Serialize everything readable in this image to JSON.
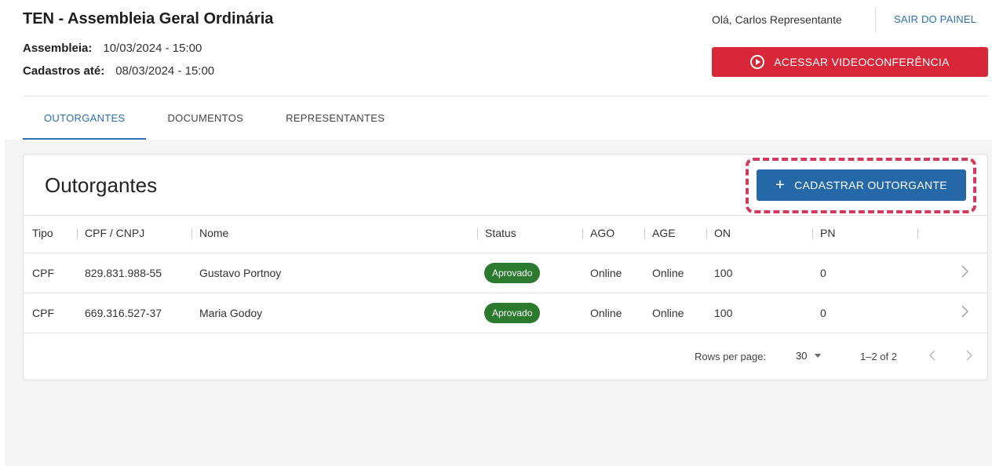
{
  "header": {
    "title": "TEN - Assembleia Geral Ordinária",
    "assembly_label": "Assembleia:",
    "assembly_value": "10/03/2024 - 15:00",
    "register_label": "Cadastros até:",
    "register_value": "08/03/2024 - 15:00",
    "greeting": "Olá, Carlos Representante",
    "logout": "SAIR DO PAINEL",
    "video_button": "ACESSAR VIDEOCONFERÊNCIA"
  },
  "tabs": [
    {
      "label": "OUTORGANTES",
      "active": true
    },
    {
      "label": "DOCUMENTOS",
      "active": false
    },
    {
      "label": "REPRESENTANTES",
      "active": false
    }
  ],
  "card": {
    "title": "Outorgantes",
    "add_button": "CADASTRAR OUTORGANTE"
  },
  "table": {
    "columns": [
      "Tipo",
      "CPF / CNPJ",
      "Nome",
      "Status",
      "AGO",
      "AGE",
      "ON",
      "PN"
    ],
    "rows": [
      {
        "tipo": "CPF",
        "doc": "829.831.988-55",
        "nome": "Gustavo Portnoy",
        "status": "Aprovado",
        "ago": "Online",
        "age": "Online",
        "on": "100",
        "pn": "0"
      },
      {
        "tipo": "CPF",
        "doc": "669.316.527-37",
        "nome": "Maria Godoy",
        "status": "Aprovado",
        "ago": "Online",
        "age": "Online",
        "on": "100",
        "pn": "0"
      }
    ]
  },
  "pagination": {
    "rows_label": "Rows per page:",
    "rows_value": "30",
    "range": "1–2 of 2"
  },
  "colors": {
    "accent": "#2c6fb6",
    "primary_button": "#2468a8",
    "danger_button": "#d82739",
    "status_approved": "#2b7a2e",
    "focus_ring": "#cf3a5d"
  }
}
